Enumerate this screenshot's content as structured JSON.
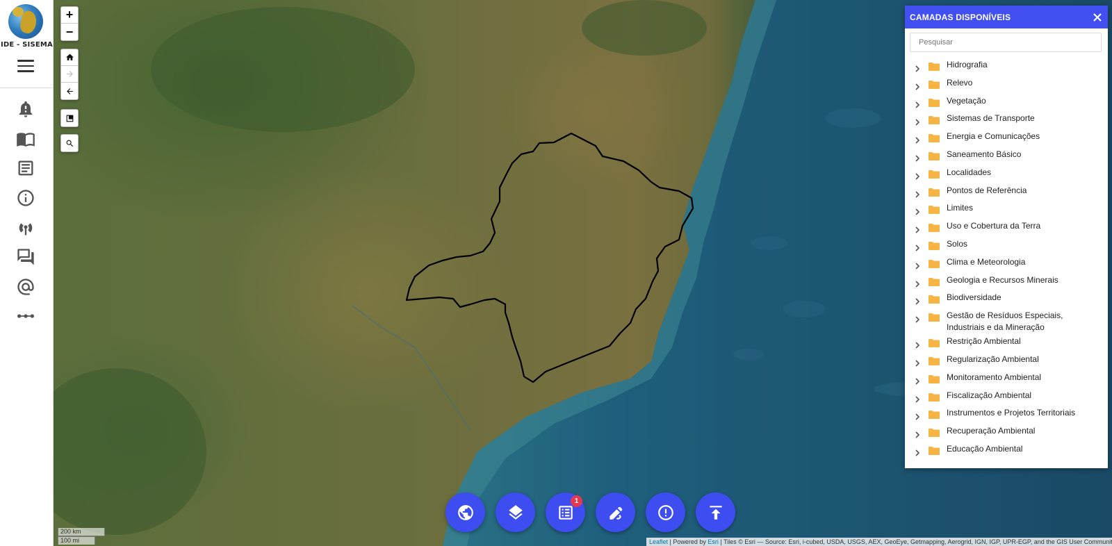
{
  "app": {
    "logo_text": "IDE - SISEMA"
  },
  "sidebar": {
    "icons": [
      {
        "name": "bell-alert-icon"
      },
      {
        "name": "book-open-icon"
      },
      {
        "name": "document-list-icon"
      },
      {
        "name": "info-circle-icon"
      },
      {
        "name": "broadcast-icon"
      },
      {
        "name": "chat-bubbles-icon"
      },
      {
        "name": "at-sign-icon"
      },
      {
        "name": "more-dots-icon"
      }
    ]
  },
  "map_controls": {
    "zoom_in": "+",
    "zoom_out": "−"
  },
  "scale": {
    "km": "200 km",
    "mi": "100 mi"
  },
  "attribution": {
    "leaflet": "Leaflet",
    "powered_by": " | Powered by ",
    "esri": "Esri",
    "tiles": " | Tiles © Esri — Source: Esri, i-cubed, USDA, USGS, AEX, GeoEye, Getmapping, Aerogrid, IGN, IGP, UPR-EGP, and the GIS User Community"
  },
  "toolbar": {
    "badge_count": "1",
    "buttons": [
      "globe-icon",
      "layers-icon",
      "list-icon",
      "draw-icon",
      "alert-icon",
      "upload-icon"
    ]
  },
  "layers_panel": {
    "title": "CAMADAS DISPONÍVEIS",
    "search_placeholder": "Pesquisar",
    "items": [
      "Hidrografia",
      "Relevo",
      "Vegetação",
      "Sistemas de Transporte",
      "Energia e Comunicações",
      "Saneamento Básico",
      "Localidades",
      "Pontos de Referência",
      "Limites",
      "Uso e Cobertura da Terra",
      "Solos",
      "Clima e Meteorologia",
      "Geologia e Recursos Minerais",
      "Biodiversidade",
      "Gestão de Resíduos Especiais, Industriais e da Mineração",
      "Restrição Ambiental",
      "Regularização Ambiental",
      "Monitoramento Ambiental",
      "Fiscalização Ambiental",
      "Instrumentos e Projetos Territoriais",
      "Recuperação Ambiental",
      "Educação Ambiental"
    ]
  }
}
